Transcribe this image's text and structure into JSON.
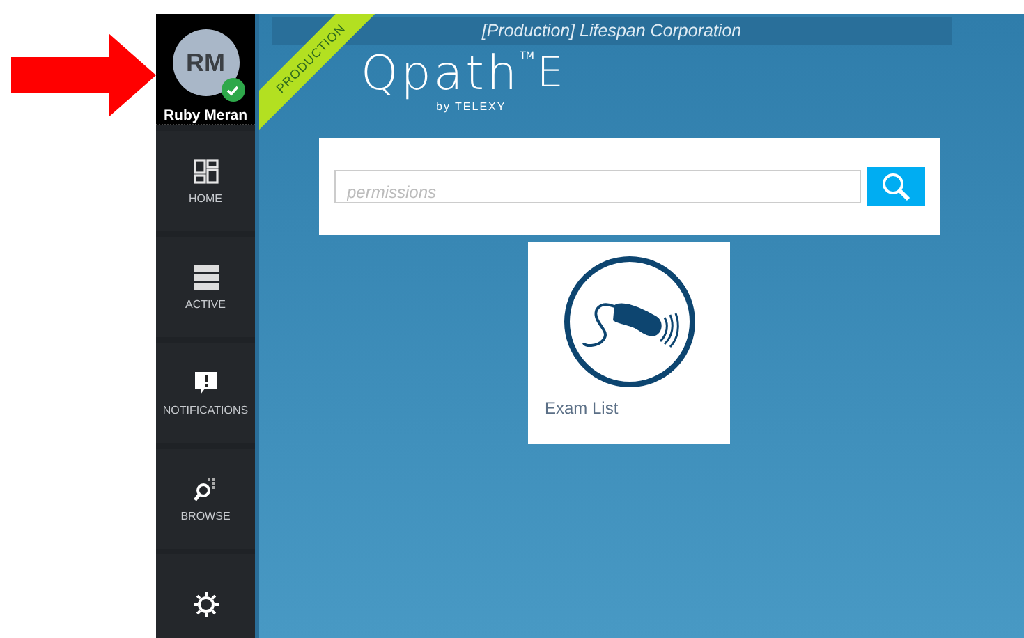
{
  "user": {
    "initials": "RM",
    "name": "Ruby Meran",
    "online": true
  },
  "sidebar": {
    "items": [
      {
        "kind": "home",
        "label": "HOME"
      },
      {
        "kind": "active",
        "label": "ACTIVE"
      },
      {
        "kind": "notifications",
        "label": "NOTIFICATIONS"
      },
      {
        "kind": "browse",
        "label": "BROWSE"
      },
      {
        "kind": "settings"
      }
    ]
  },
  "header": {
    "title": "[Production] Lifespan Corporation",
    "ribbon": "PRODUCTION"
  },
  "logo": {
    "name": "Qpath",
    "trademark": "TM",
    "suffix": "E",
    "byline": "by",
    "brand": "TELEXY"
  },
  "search": {
    "placeholder": "permissions"
  },
  "tiles": [
    {
      "label": "Exam List"
    }
  ]
}
